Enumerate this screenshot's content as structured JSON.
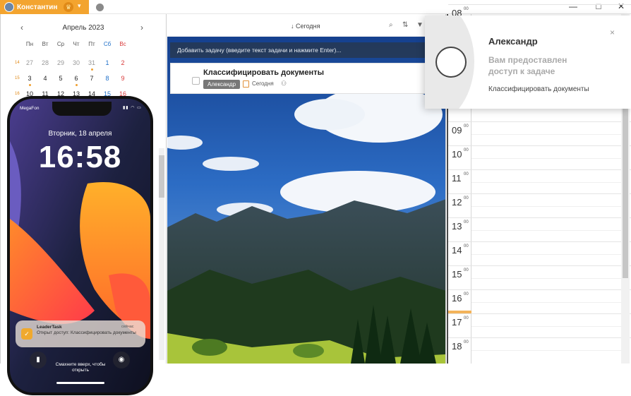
{
  "titlebar": {
    "user_name": "Константин",
    "window_controls": [
      "—",
      "□",
      "✕"
    ]
  },
  "calendar": {
    "month_label": "Апрель 2023",
    "prev_icon": "chevron-left-icon",
    "next_icon": "chevron-right-icon",
    "weekdays": [
      "Пн",
      "Вт",
      "Ср",
      "Чт",
      "Пт",
      "Сб",
      "Вс"
    ],
    "weeks": [
      {
        "num": "14",
        "days": [
          "27",
          "28",
          "29",
          "30",
          "31",
          "1",
          "2"
        ]
      },
      {
        "num": "15",
        "days": [
          "3",
          "4",
          "5",
          "6",
          "7",
          "8",
          "9"
        ]
      },
      {
        "num": "16",
        "days": [
          "10",
          "11",
          "12",
          "13",
          "14",
          "15",
          "16"
        ]
      }
    ]
  },
  "toolbar": {
    "today_label": "Сегодня",
    "icons": [
      "search-icon",
      "sort-icon",
      "filter-icon"
    ]
  },
  "tasks": {
    "add_placeholder": "Добавить задачу (введите текст задачи и нажмите Enter)...",
    "items": [
      {
        "title": "Классифицировать документы",
        "assignee": "Александр",
        "date": "Сегодня"
      }
    ]
  },
  "day_view": {
    "hours": [
      "08",
      "09",
      "10",
      "11",
      "12",
      "13",
      "14",
      "15",
      "16",
      "17",
      "18"
    ],
    "minutes": "00"
  },
  "notification": {
    "name": "Александр",
    "message": "Вам предоставлен доступ к задаче",
    "task": "Классифицировать документы",
    "close": "×"
  },
  "phone": {
    "carrier": "MegaFon",
    "date": "Вторник, 18 апреля",
    "time": "16:58",
    "push_app": "LeaderTask",
    "push_time": "сейчас",
    "push_text": "Открыт доступ: Классифицировать документы",
    "swipe_text": "Смахните вверх, чтобы открыть"
  },
  "colors": {
    "accent": "#f3a42f",
    "weekend_blue": "#1e6fc8",
    "sunday_red": "#d93a3a"
  }
}
